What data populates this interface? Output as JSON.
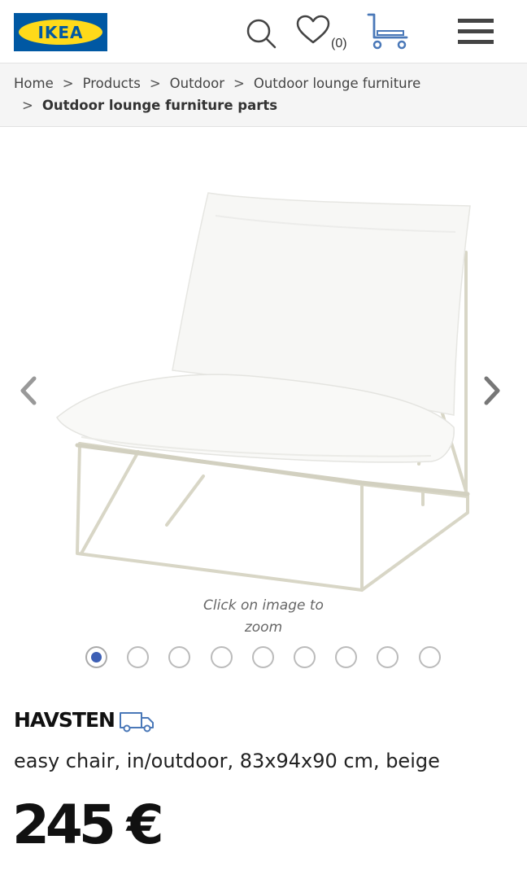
{
  "header": {
    "logo_text": "IKEA",
    "brand_blue": "#0058a3",
    "brand_yellow": "#ffda1a",
    "wishlist_count": "(0)",
    "icons": [
      "search-icon",
      "heart-icon",
      "cart-icon",
      "menu-icon"
    ]
  },
  "breadcrumb": {
    "items": [
      "Home",
      "Products",
      "Outdoor",
      "Outdoor lounge furniture",
      "Outdoor lounge furniture parts"
    ],
    "separator": ">"
  },
  "gallery": {
    "zoom_hint_line1": "Click on image to",
    "zoom_hint_line2": "zoom",
    "image_count": 9,
    "active_index": 0,
    "active_color": "#3d5fb5"
  },
  "product": {
    "name": "HAVSTEN",
    "description": "easy chair, in/outdoor, 83x94x90 cm, beige",
    "price": "245 €",
    "delivery_icon": "truck-icon"
  }
}
